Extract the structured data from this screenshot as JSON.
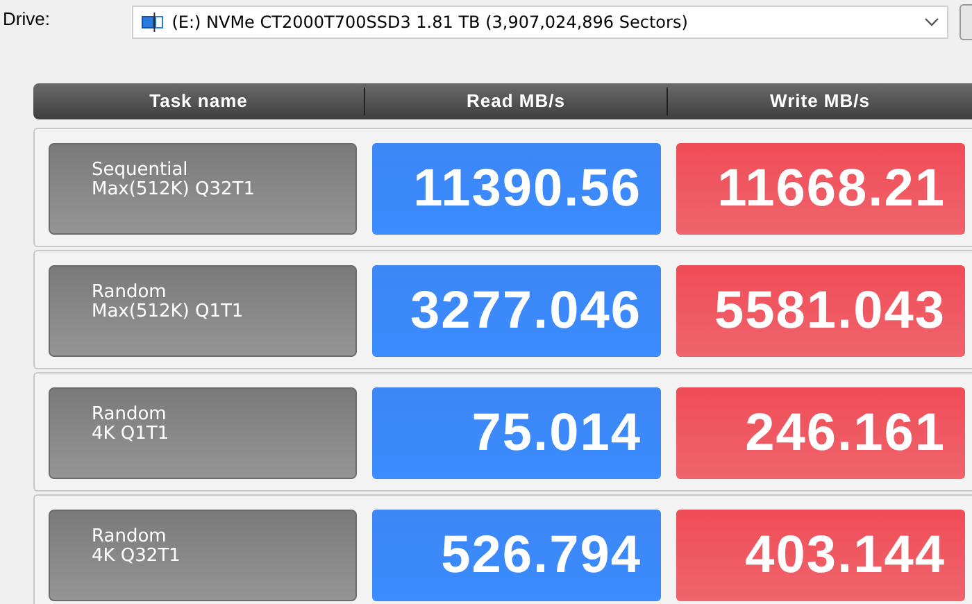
{
  "drive": {
    "label": "Drive:",
    "value": "(E:) NVMe CT2000T700SSD3  1.81 TB (3,907,024,896 Sectors)"
  },
  "table": {
    "columns": [
      "Task name",
      "Read MB/s",
      "Write MB/s"
    ],
    "rows": [
      {
        "task": "Sequential\nMax(512K) Q32T1",
        "read": "11390.56",
        "write": "11668.21"
      },
      {
        "task": "Random\nMax(512K) Q1T1",
        "read": "3277.046",
        "write": "5581.043"
      },
      {
        "task": "Random\n4K Q1T1",
        "read": "75.014",
        "write": "246.161"
      },
      {
        "task": "Random\n4K Q32T1",
        "read": "526.794",
        "write": "403.144"
      }
    ]
  }
}
